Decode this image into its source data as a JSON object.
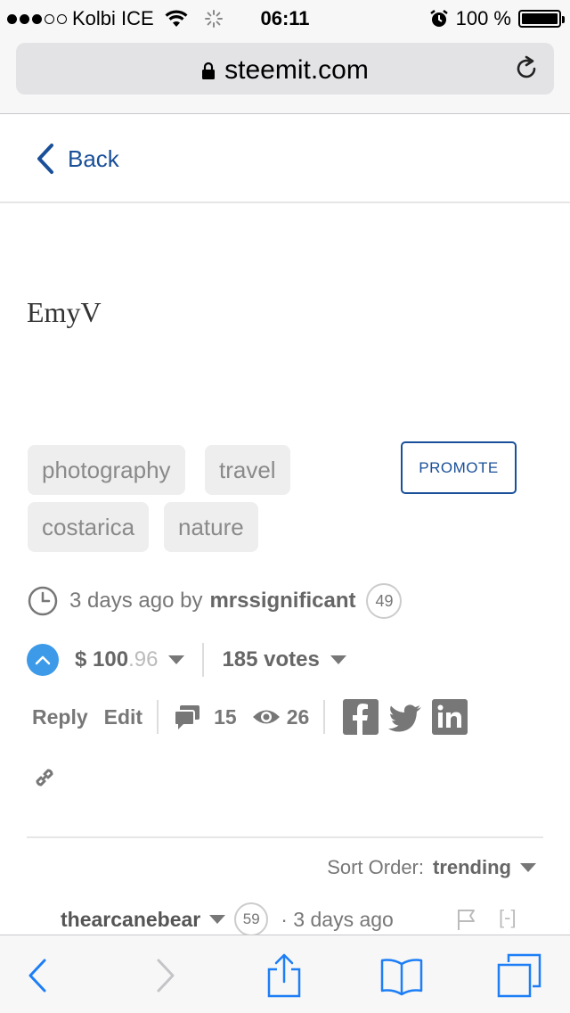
{
  "status_bar": {
    "carrier": "Kolbi ICE",
    "time": "06:11",
    "battery_percent": "100 %",
    "battery_level": 1.0
  },
  "browser": {
    "url": "steemit.com"
  },
  "nav": {
    "back_label": "Back"
  },
  "post": {
    "title": "EmyV",
    "tags": [
      "photography",
      "travel",
      "costarica",
      "nature"
    ],
    "promote_label": "PROMOTE",
    "time_ago": "3 days ago by",
    "author": "mrssignificant",
    "author_rep": "49",
    "payout_currency": "$",
    "payout_dollars": "100",
    "payout_cents": ".96",
    "votes": "185 votes",
    "reply_label": "Reply",
    "edit_label": "Edit",
    "comments_count": "15",
    "views_count": "26"
  },
  "comments": {
    "sort_label": "Sort Order:",
    "sort_value": "trending",
    "first": {
      "author": "thearcanebear",
      "rep": "59",
      "time": "· 3 days ago",
      "collapse": "[-]"
    }
  },
  "colors": {
    "link_blue": "#1a5099",
    "upvote_blue": "#3c9ae8",
    "safari_blue": "#1d7ef6"
  },
  "icons": [
    "clock-icon",
    "upvote-icon",
    "chevron-down-icon",
    "comment-icon",
    "eye-icon",
    "facebook-icon",
    "twitter-icon",
    "linkedin-icon",
    "link-icon",
    "flag-icon",
    "lock-icon",
    "reload-icon",
    "share-icon",
    "bookmarks-icon",
    "tabs-icon"
  ]
}
